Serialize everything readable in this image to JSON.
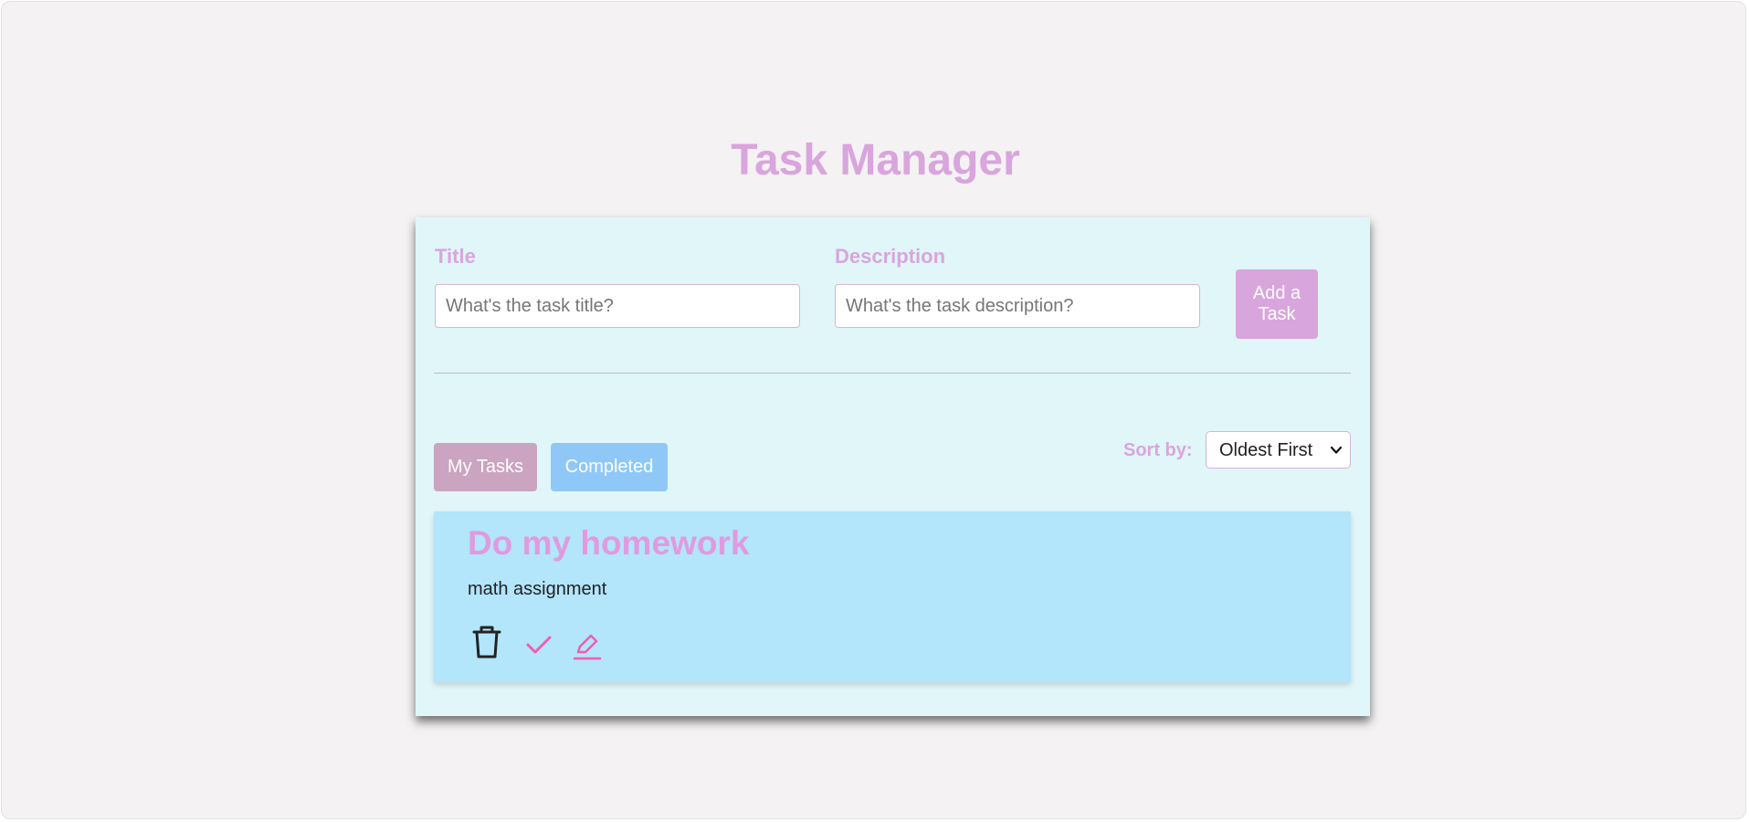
{
  "header": {
    "title": "Task Manager"
  },
  "form": {
    "title_label": "Title",
    "title_placeholder": "What's the task title?",
    "title_value": "",
    "description_label": "Description",
    "description_placeholder": "What's the task description?",
    "description_value": "",
    "add_button_label": "Add a Task"
  },
  "tabs": [
    {
      "label": "My Tasks",
      "active": true
    },
    {
      "label": "Completed",
      "active": false
    }
  ],
  "sort": {
    "label": "Sort by:",
    "selected": "Oldest First"
  },
  "tasks": [
    {
      "title": "Do my homework",
      "description": "math assignment",
      "actions": [
        "trash-icon",
        "check-icon",
        "edit-icon"
      ]
    }
  ],
  "colors": {
    "accent": "#d9a5dd",
    "panel_bg": "#e0f6f8",
    "card_bg": "#b3e5fb",
    "tab_active": "#cba4c1",
    "tab_inactive": "#8fc8f7",
    "icon_pink": "#ee5fb1"
  }
}
